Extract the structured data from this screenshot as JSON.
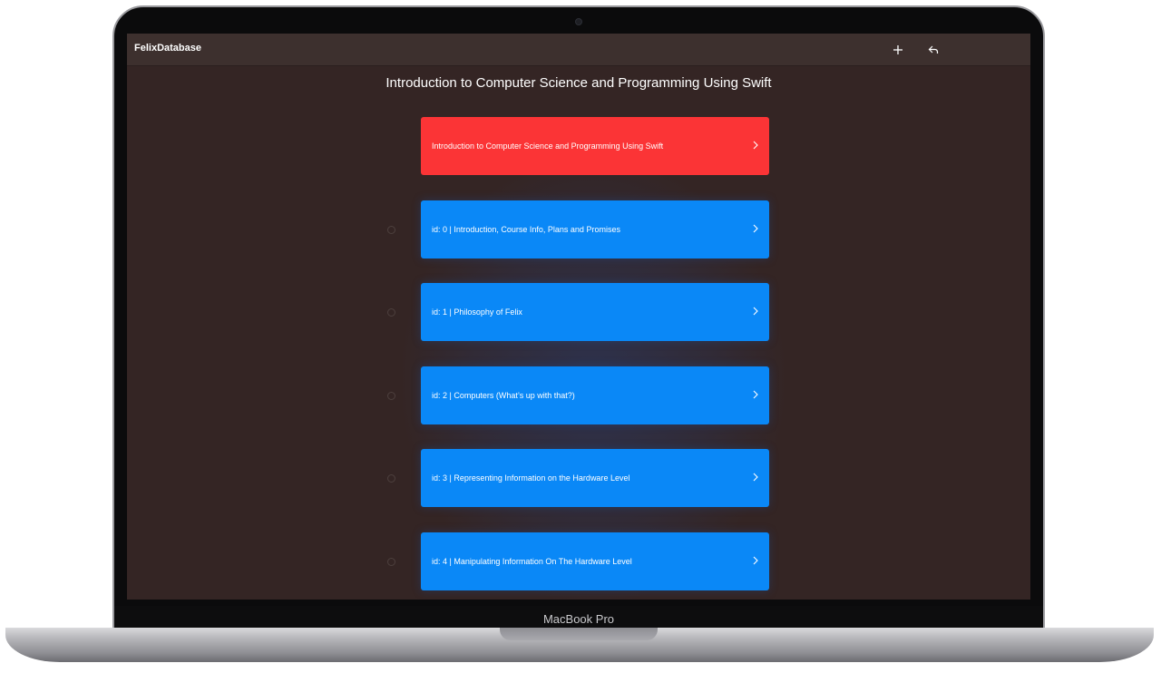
{
  "device": {
    "brand_label": "MacBook Pro"
  },
  "app": {
    "title": "FelixDatabase",
    "toolbar": {
      "add_icon": "plus-icon",
      "back_icon": "reply-back-icon"
    }
  },
  "page": {
    "heading": "Introduction to Computer Science and Programming Using Swift"
  },
  "list": {
    "items": [
      {
        "label": "Introduction to Computer Science and Programming Using Swift",
        "color": "#fb3436",
        "has_radio": false
      },
      {
        "label": "id: 0 | Introduction, Course Info, Plans and Promises",
        "color": "#0a88f7",
        "has_radio": true
      },
      {
        "label": "id: 1 | Philosophy of Felix",
        "color": "#0a88f7",
        "has_radio": true
      },
      {
        "label": "id: 2 | Computers (What’s up with that?)",
        "color": "#0a88f7",
        "has_radio": true
      },
      {
        "label": "id: 3 | Representing Information on the Hardware Level",
        "color": "#0a88f7",
        "has_radio": true
      },
      {
        "label": "id: 4 | Manipulating Information On The Hardware Level",
        "color": "#0a88f7",
        "has_radio": true
      }
    ],
    "chevron_icon": "chevron-right-icon"
  },
  "colors": {
    "background": "#342524",
    "toolbar": "#3d302e",
    "accent_blue": "#0a88f7",
    "accent_red": "#fb3436"
  }
}
